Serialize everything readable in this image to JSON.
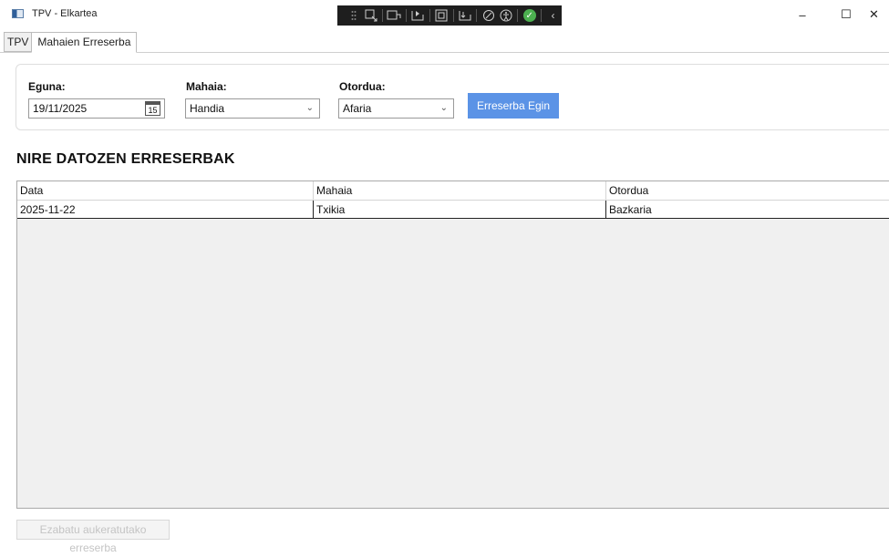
{
  "window": {
    "title": "TPV - Elkartea",
    "minimize_glyph": "–",
    "maximize_glyph": "☐",
    "close_glyph": "✕"
  },
  "devtools": {
    "check_glyph": "✓",
    "chevron_glyph": "‹"
  },
  "tabs": [
    {
      "label": "TPV",
      "active": false
    },
    {
      "label": "Mahaien Erreserba",
      "active": true
    }
  ],
  "form": {
    "date_label": "Eguna:",
    "date_value": "19/11/2025",
    "calendar_day": "15",
    "table_label": "Mahaia:",
    "table_value": "Handia",
    "meal_label": "Otordua:",
    "meal_value": "Afaria",
    "dropdown_glyph": "⌄",
    "submit_label": "Erreserba Egin"
  },
  "reservations": {
    "title": "NIRE DATOZEN ERRESERBAK",
    "columns": [
      "Data",
      "Mahaia",
      "Otordua"
    ],
    "rows": [
      [
        "2025-11-22",
        "Txikia",
        "Bazkaria"
      ]
    ]
  },
  "footer": {
    "cancel_label": "Ezabatu aukeratutako erreserba"
  },
  "colors": {
    "primary_button": "#5b93e6",
    "devtools_bg": "#1e1e1e",
    "grid_bg": "#f0f0f0"
  }
}
